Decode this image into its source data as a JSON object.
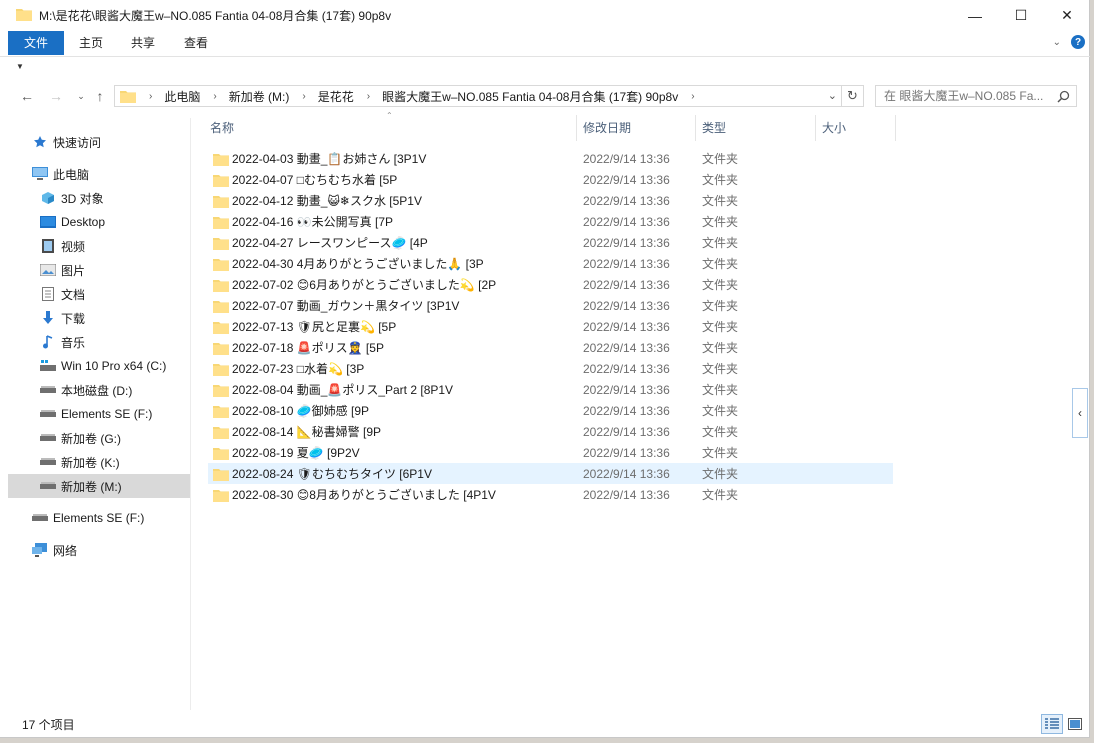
{
  "window": {
    "title": "M:\\是花花\\眼酱大魔王w–NO.085 Fantia 04-08月合集 (17套) 90p8v",
    "minimize": "—",
    "maximize": "☐",
    "close": "✕"
  },
  "ribbon": {
    "tabs": [
      "文件",
      "主页",
      "共享",
      "查看"
    ]
  },
  "address": {
    "crumbs": [
      "此电脑",
      "新加卷 (M:)",
      "是花花",
      "眼酱大魔王w–NO.085 Fantia 04-08月合集 (17套) 90p8v"
    ],
    "search_placeholder": "在 眼酱大魔王w–NO.085 Fa..."
  },
  "nav": {
    "items": [
      {
        "label": "快速访问",
        "icon": "star-icon"
      },
      {
        "label": "此电脑",
        "icon": "computer-icon"
      },
      {
        "label": "3D 对象",
        "icon": "3d-objects-icon"
      },
      {
        "label": "Desktop",
        "icon": "desktop-icon"
      },
      {
        "label": "视频",
        "icon": "video-icon"
      },
      {
        "label": "图片",
        "icon": "picture-icon"
      },
      {
        "label": "文档",
        "icon": "document-icon"
      },
      {
        "label": "下载",
        "icon": "download-icon"
      },
      {
        "label": "音乐",
        "icon": "music-icon"
      },
      {
        "label": "Win 10 Pro x64 (C:)",
        "icon": "windows-drive-icon"
      },
      {
        "label": "本地磁盘 (D:)",
        "icon": "drive-icon"
      },
      {
        "label": "Elements SE (F:)",
        "icon": "drive-icon"
      },
      {
        "label": "新加卷 (G:)",
        "icon": "drive-icon"
      },
      {
        "label": "新加卷 (K:)",
        "icon": "drive-icon"
      },
      {
        "label": "新加卷 (M:)",
        "icon": "drive-icon"
      },
      {
        "label": "Elements SE (F:)",
        "icon": "drive-icon"
      },
      {
        "label": "网络",
        "icon": "network-icon"
      }
    ]
  },
  "columns": {
    "name": "名称",
    "date": "修改日期",
    "type": "类型",
    "size": "大小"
  },
  "files": [
    {
      "name": "2022-04-03 動畫_📋お姉さん [3P1V",
      "date": "2022/9/14 13:36",
      "type": "文件夹"
    },
    {
      "name": "2022-04-07 □むちむち水着 [5P",
      "date": "2022/9/14 13:36",
      "type": "文件夹"
    },
    {
      "name": "2022-04-12 動畫_😺❄スク水 [5P1V",
      "date": "2022/9/14 13:36",
      "type": "文件夹"
    },
    {
      "name": "2022-04-16 👀未公開写真 [7P",
      "date": "2022/9/14 13:36",
      "type": "文件夹"
    },
    {
      "name": "2022-04-27 レースワンピース🥏 [4P",
      "date": "2022/9/14 13:36",
      "type": "文件夹"
    },
    {
      "name": "2022-04-30 4月ありがとうございました🙏 [3P",
      "date": "2022/9/14 13:36",
      "type": "文件夹"
    },
    {
      "name": "2022-07-02 😊6月ありがとうございました💫 [2P",
      "date": "2022/9/14 13:36",
      "type": "文件夹"
    },
    {
      "name": "2022-07-07 動画_ガウン＋黒タイツ [3P1V",
      "date": "2022/9/14 13:36",
      "type": "文件夹"
    },
    {
      "name": "2022-07-13 🛡尻と足裏💫 [5P",
      "date": "2022/9/14 13:36",
      "type": "文件夹"
    },
    {
      "name": "2022-07-18 🚨ポリス👮‍♀ [5P",
      "date": "2022/9/14 13:36",
      "type": "文件夹"
    },
    {
      "name": "2022-07-23 □水着💫 [3P",
      "date": "2022/9/14 13:36",
      "type": "文件夹"
    },
    {
      "name": "2022-08-04 動画_🚨ポリス_Part 2 [8P1V",
      "date": "2022/9/14 13:36",
      "type": "文件夹"
    },
    {
      "name": "2022-08-10 🥏御姉感 [9P",
      "date": "2022/9/14 13:36",
      "type": "文件夹"
    },
    {
      "name": "2022-08-14 📐秘書婦警 [9P",
      "date": "2022/9/14 13:36",
      "type": "文件夹"
    },
    {
      "name": "2022-08-19 夏🥏 [9P2V",
      "date": "2022/9/14 13:36",
      "type": "文件夹"
    },
    {
      "name": "2022-08-24 🛡むちむちタイツ [6P1V",
      "date": "2022/9/14 13:36",
      "type": "文件夹"
    },
    {
      "name": "2022-08-30 😊8月ありがとうございました [4P1V",
      "date": "2022/9/14 13:36",
      "type": "文件夹"
    }
  ],
  "status": {
    "count": "17 个项目"
  }
}
